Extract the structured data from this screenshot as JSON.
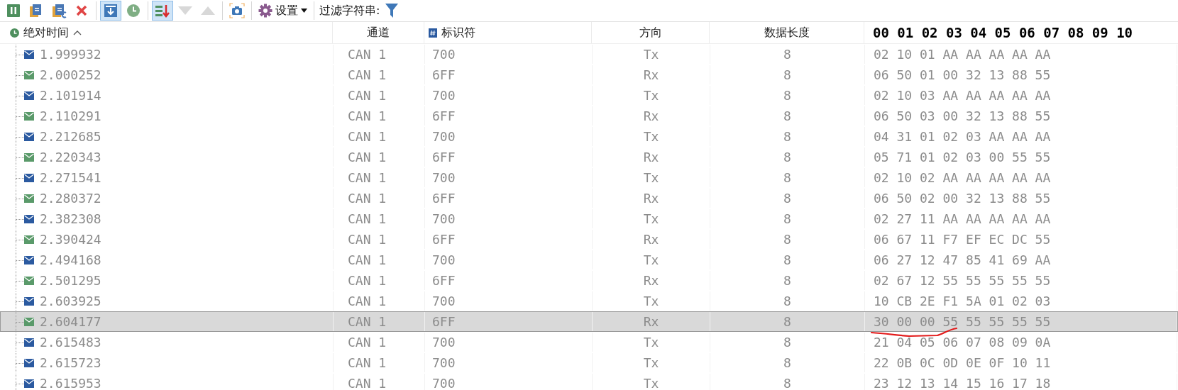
{
  "toolbar": {
    "buttons": [
      {
        "kind": "pause",
        "selected": false
      },
      {
        "kind": "copy",
        "selected": false
      },
      {
        "kind": "copy-format",
        "selected": false
      },
      {
        "kind": "clear",
        "selected": false
      },
      {
        "kind": "autoscroll",
        "selected": true
      },
      {
        "kind": "clock",
        "selected": false
      },
      {
        "kind": "sort",
        "selected": true
      },
      {
        "kind": "down",
        "selected": false,
        "disabled": true
      },
      {
        "kind": "up",
        "selected": false,
        "disabled": true
      },
      {
        "kind": "camera",
        "selected": false
      }
    ],
    "settings_label": "设置",
    "filter_label": "过滤字符串:"
  },
  "columns": [
    {
      "label": "绝对时间",
      "kind": "time"
    },
    {
      "label": "通道",
      "kind": "channel"
    },
    {
      "label": "标识符",
      "kind": "id"
    },
    {
      "label": "方向",
      "kind": "direction"
    },
    {
      "label": "数据长度",
      "kind": "length"
    },
    {
      "label": "00 01 02 03 04 05 06 07 08 09 10",
      "kind": "data"
    }
  ],
  "rows": [
    {
      "time": "1.999932",
      "channel": "CAN 1",
      "id": "700",
      "direction": "Tx",
      "length": "8",
      "data": "02 10 01 AA AA AA AA AA",
      "kind": "tx",
      "selected": false
    },
    {
      "time": "2.000252",
      "channel": "CAN 1",
      "id": "6FF",
      "direction": "Rx",
      "length": "8",
      "data": "06 50 01 00 32 13 88 55",
      "kind": "rx",
      "selected": false
    },
    {
      "time": "2.101914",
      "channel": "CAN 1",
      "id": "700",
      "direction": "Tx",
      "length": "8",
      "data": "02 10 03 AA AA AA AA AA",
      "kind": "tx",
      "selected": false
    },
    {
      "time": "2.110291",
      "channel": "CAN 1",
      "id": "6FF",
      "direction": "Rx",
      "length": "8",
      "data": "06 50 03 00 32 13 88 55",
      "kind": "rx",
      "selected": false
    },
    {
      "time": "2.212685",
      "channel": "CAN 1",
      "id": "700",
      "direction": "Tx",
      "length": "8",
      "data": "04 31 01 02 03 AA AA AA",
      "kind": "tx",
      "selected": false
    },
    {
      "time": "2.220343",
      "channel": "CAN 1",
      "id": "6FF",
      "direction": "Rx",
      "length": "8",
      "data": "05 71 01 02 03 00 55 55",
      "kind": "rx",
      "selected": false
    },
    {
      "time": "2.271541",
      "channel": "CAN 1",
      "id": "700",
      "direction": "Tx",
      "length": "8",
      "data": "02 10 02 AA AA AA AA AA",
      "kind": "tx",
      "selected": false
    },
    {
      "time": "2.280372",
      "channel": "CAN 1",
      "id": "6FF",
      "direction": "Rx",
      "length": "8",
      "data": "06 50 02 00 32 13 88 55",
      "kind": "rx",
      "selected": false
    },
    {
      "time": "2.382308",
      "channel": "CAN 1",
      "id": "700",
      "direction": "Tx",
      "length": "8",
      "data": "02 27 11 AA AA AA AA AA",
      "kind": "tx",
      "selected": false
    },
    {
      "time": "2.390424",
      "channel": "CAN 1",
      "id": "6FF",
      "direction": "Rx",
      "length": "8",
      "data": "06 67 11 F7 EF EC DC 55",
      "kind": "rx",
      "selected": false
    },
    {
      "time": "2.494168",
      "channel": "CAN 1",
      "id": "700",
      "direction": "Tx",
      "length": "8",
      "data": "06 27 12 47 85 41 69 AA",
      "kind": "tx",
      "selected": false
    },
    {
      "time": "2.501295",
      "channel": "CAN 1",
      "id": "6FF",
      "direction": "Rx",
      "length": "8",
      "data": "02 67 12 55 55 55 55 55",
      "kind": "rx",
      "selected": false
    },
    {
      "time": "2.603925",
      "channel": "CAN 1",
      "id": "700",
      "direction": "Tx",
      "length": "8",
      "data": "10 CB 2E F1 5A 01 02 03",
      "kind": "tx",
      "selected": false
    },
    {
      "time": "2.604177",
      "channel": "CAN 1",
      "id": "6FF",
      "direction": "Rx",
      "length": "8",
      "data": "30 00 00 55 55 55 55 55",
      "kind": "rx",
      "selected": true
    },
    {
      "time": "2.615483",
      "channel": "CAN 1",
      "id": "700",
      "direction": "Tx",
      "length": "8",
      "data": "21 04 05 06 07 08 09 0A",
      "kind": "tx",
      "selected": false
    },
    {
      "time": "2.615723",
      "channel": "CAN 1",
      "id": "700",
      "direction": "Tx",
      "length": "8",
      "data": "22 0B 0C 0D 0E 0F 10 11",
      "kind": "tx",
      "selected": false
    },
    {
      "time": "2.615953",
      "channel": "CAN 1",
      "id": "700",
      "direction": "Tx",
      "length": "8",
      "data": "23 12 13 14 15 16 17 18",
      "kind": "tx",
      "selected": false
    }
  ]
}
